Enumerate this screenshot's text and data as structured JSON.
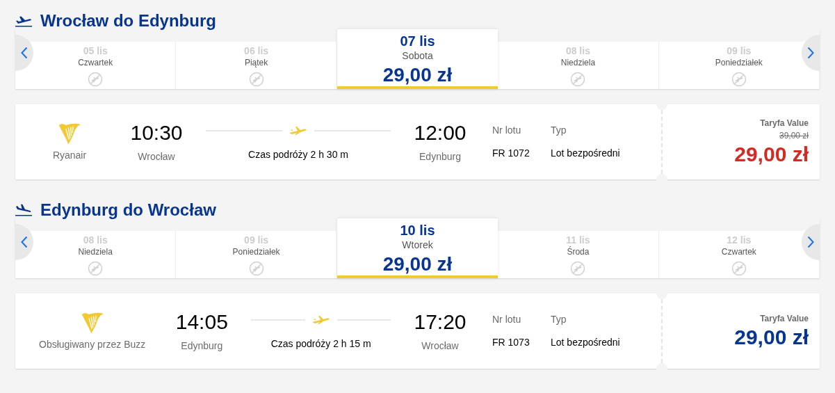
{
  "sections": [
    {
      "title": "Wrocław do Edynburg",
      "kind": "departure",
      "dates": [
        {
          "date": "05 lis",
          "day": "Czwartek",
          "available": false,
          "selected": false
        },
        {
          "date": "06 lis",
          "day": "Piątek",
          "available": false,
          "selected": false
        },
        {
          "date": "07 lis",
          "day": "Sobota",
          "price": "29,00 zł",
          "available": true,
          "selected": true
        },
        {
          "date": "08 lis",
          "day": "Niedziela",
          "available": false,
          "selected": false
        },
        {
          "date": "09 lis",
          "day": "Poniedziałek",
          "available": false,
          "selected": false
        }
      ],
      "flight": {
        "airline": "Ryanair",
        "dep_time": "10:30",
        "dep_city": "Wrocław",
        "duration": "Czas podróży 2 h 30 m",
        "arr_time": "12:00",
        "arr_city": "Edynburg",
        "flight_no_label": "Nr lotu",
        "flight_no": "FR 1072",
        "type_label": "Typ",
        "type": "Lot bezpośredni",
        "fare_label": "Taryfa Value",
        "old_price": "39,00 zł",
        "price": "29,00 zł"
      }
    },
    {
      "title": "Edynburg do Wrocław",
      "kind": "return",
      "dates": [
        {
          "date": "08 lis",
          "day": "Niedziela",
          "available": false,
          "selected": false
        },
        {
          "date": "09 lis",
          "day": "Poniedziałek",
          "available": false,
          "selected": false
        },
        {
          "date": "10 lis",
          "day": "Wtorek",
          "price": "29,00 zł",
          "available": true,
          "selected": true
        },
        {
          "date": "11 lis",
          "day": "Środa",
          "available": false,
          "selected": false
        },
        {
          "date": "12 lis",
          "day": "Czwartek",
          "available": false,
          "selected": false
        }
      ],
      "flight": {
        "airline": "Obsługiwany przez Buzz",
        "dep_time": "14:05",
        "dep_city": "Edynburg",
        "duration": "Czas podróży 2 h 15 m",
        "arr_time": "17:20",
        "arr_city": "Wrocław",
        "flight_no_label": "Nr lotu",
        "flight_no": "FR 1073",
        "type_label": "Typ",
        "type": "Lot bezpośredni",
        "fare_label": "Taryfa Value",
        "price": "29,00 zł"
      }
    }
  ]
}
